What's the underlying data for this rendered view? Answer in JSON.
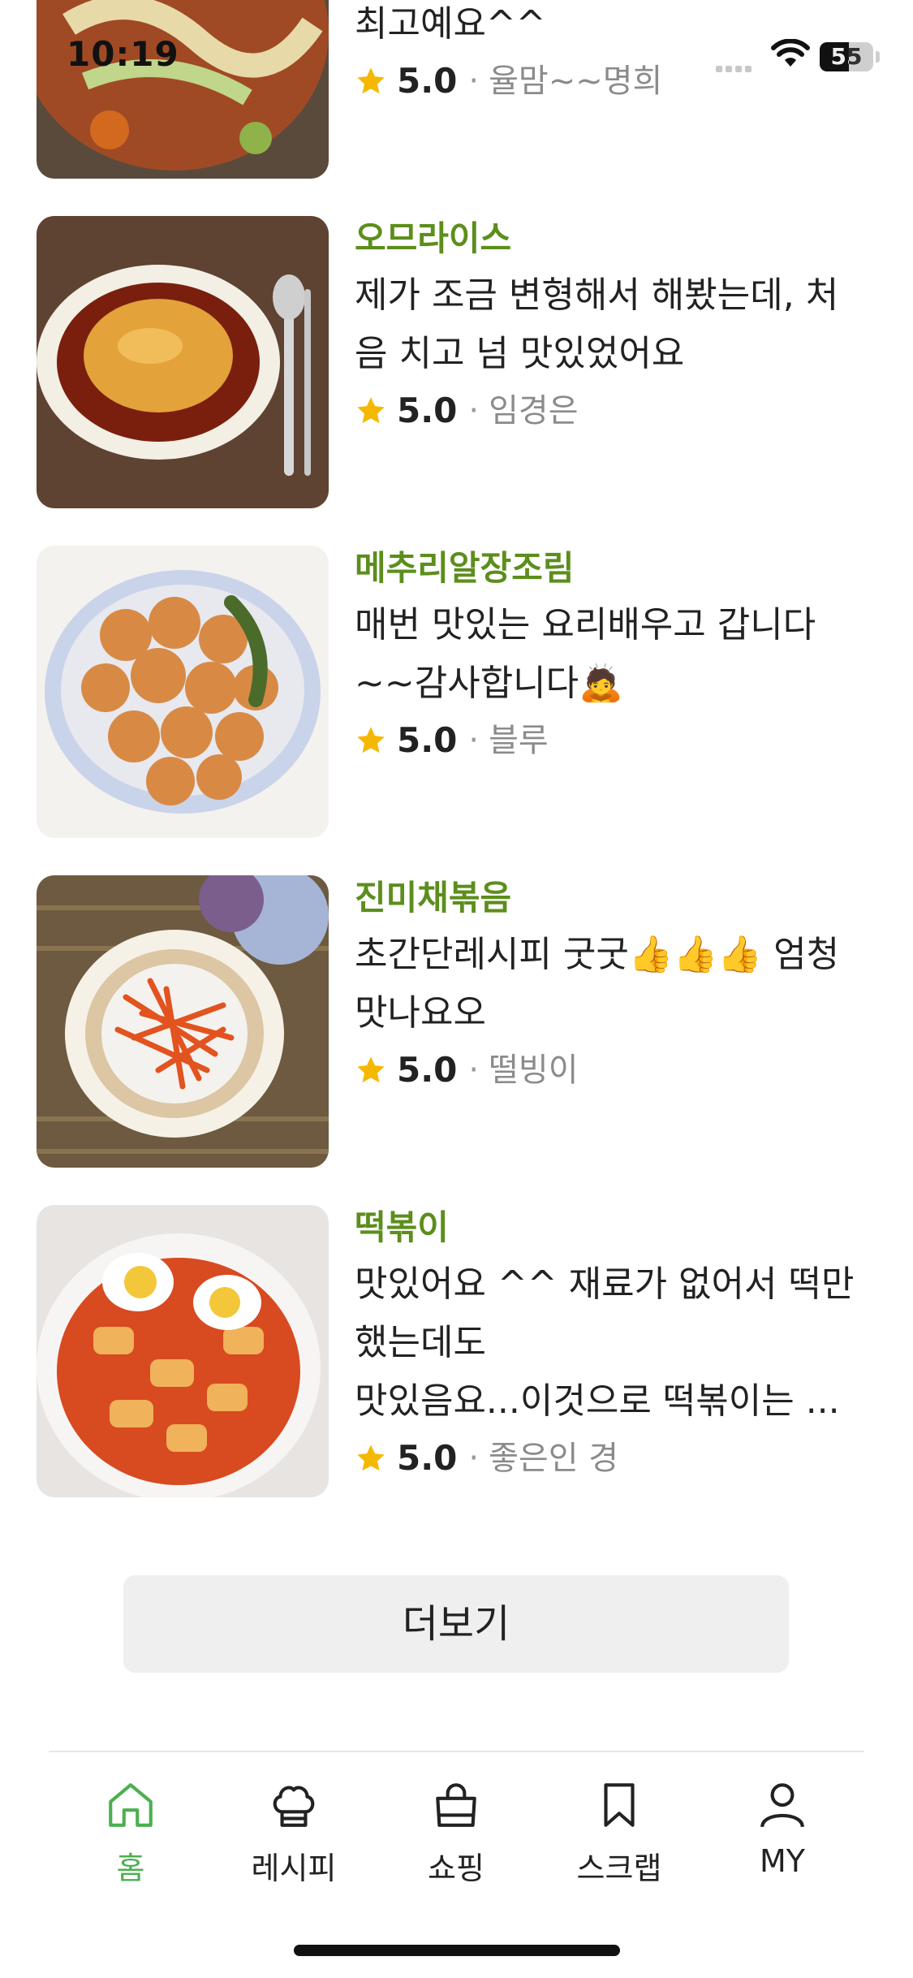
{
  "status": {
    "time": "10:19",
    "battery": "55"
  },
  "reviews": [
    {
      "title": "",
      "text": "너무 맛있어요\n최고예요^^",
      "score": "5.0",
      "author": "율맘~~명희"
    },
    {
      "title": "오므라이스",
      "text": "제가 조금 변형해서 해봤는데, 처\n음 치고 넘 맛있었어요",
      "score": "5.0",
      "author": "임경은"
    },
    {
      "title": "메추리알장조림",
      "text": "매번 맛있는 요리배우고 갑니다\n~~감사합니다🙇",
      "score": "5.0",
      "author": "블루"
    },
    {
      "title": "진미채볶음",
      "text": "초간단레시피 굿굿👍👍👍 엄청\n맛나요오",
      "score": "5.0",
      "author": "떨빙이"
    },
    {
      "title": "떡볶이",
      "text": "맛있어요 ^^ 재료가 없어서 떡만\n했는데도\n맛있음요...이것으로 떡볶이는 ...",
      "score": "5.0",
      "author": "좋은인 경"
    }
  ],
  "more_button": "더보기",
  "tabs": [
    {
      "label": "홈",
      "icon": "home-icon",
      "active": true
    },
    {
      "label": "레시피",
      "icon": "chef-hat-icon",
      "active": false
    },
    {
      "label": "쇼핑",
      "icon": "shopping-bag-icon",
      "active": false
    },
    {
      "label": "스크랩",
      "icon": "bookmark-icon",
      "active": false
    },
    {
      "label": "MY",
      "icon": "user-icon",
      "active": false
    }
  ],
  "colors": {
    "accent": "#5c8e1c",
    "tab_active": "#4caf50",
    "star": "#f5b800"
  }
}
